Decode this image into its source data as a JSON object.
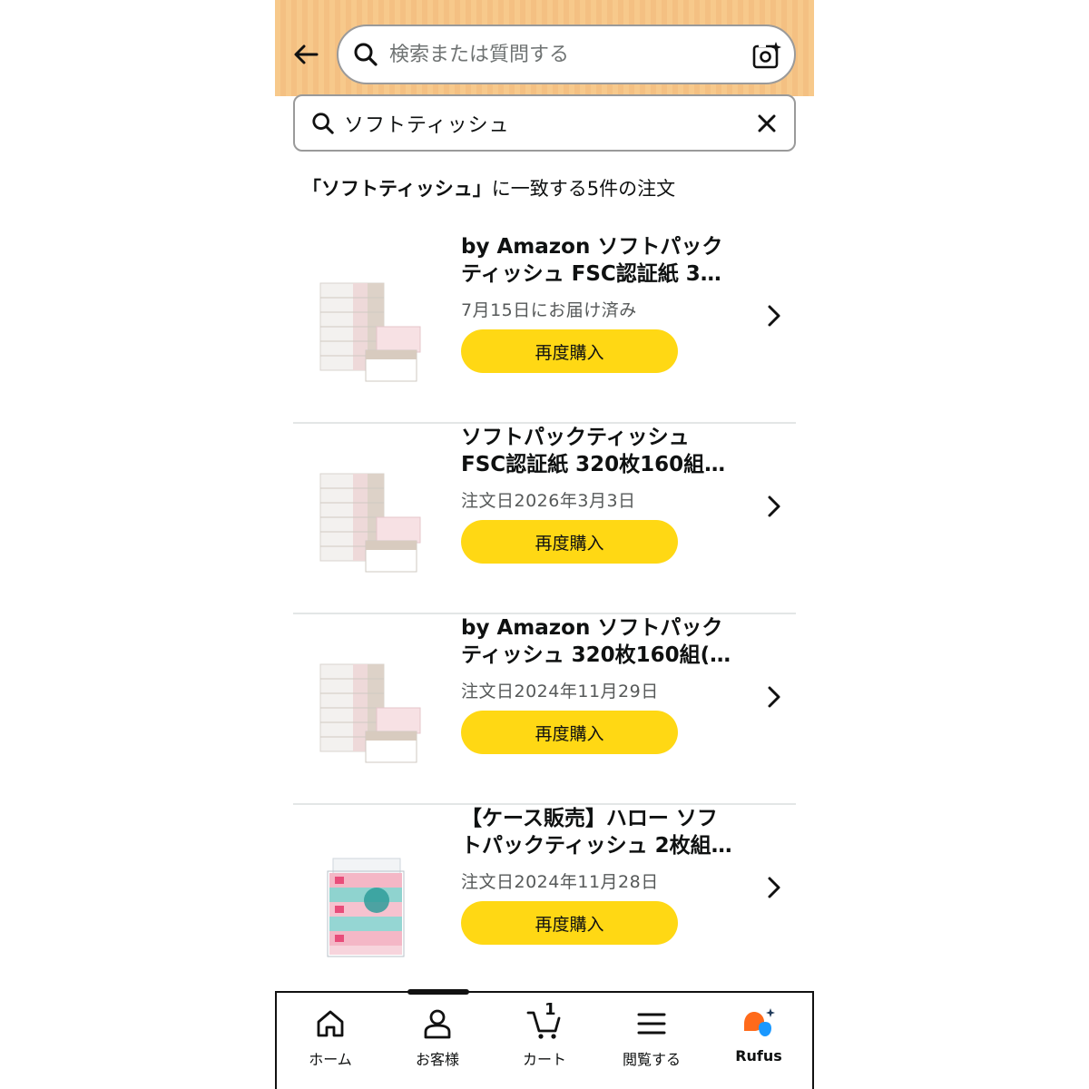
{
  "header": {
    "search_placeholder": "検索または質問する"
  },
  "order_search": {
    "value": "ソフトティッシュ"
  },
  "results": {
    "query_quoted": "「ソフトティッシュ」",
    "suffix": "に一致する5件の注文"
  },
  "orders": [
    {
      "title_line1": "by Amazon ソフトパック",
      "title_line2": "ティッシュ FSC認証紙 3…",
      "status": "7月15日にお届け済み",
      "button": "再度購入",
      "image": "soft-pack-tissue-white-box"
    },
    {
      "title_line1": "ソフトパックティッシュ",
      "title_line2": "FSC認証紙 320枚160組…",
      "status": "注文日2026年3月3日",
      "button": "再度購入",
      "image": "soft-pack-tissue-white-box"
    },
    {
      "title_line1": "by Amazon ソフトパック",
      "title_line2": "ティッシュ 320枚160組(…",
      "status": "注文日2024年11月29日",
      "button": "再度購入",
      "image": "soft-pack-tissue-white-box"
    },
    {
      "title_line1": "【ケース販売】ハロー ソフ",
      "title_line2": "トパックティッシュ 2枚組…",
      "status": "注文日2024年11月28日",
      "button": "再度購入",
      "image": "hello-soft-pack-tissue-colorful"
    }
  ],
  "nav": {
    "home": "ホーム",
    "account": "お客様",
    "cart": "カート",
    "cart_count": "1",
    "browse": "閲覧する",
    "rufus": "Rufus"
  },
  "colors": {
    "header_bg": "#f7c98b",
    "buy_again": "#ffd814",
    "rufus_orange": "#ff6a1a",
    "rufus_blue": "#1a98ff"
  }
}
